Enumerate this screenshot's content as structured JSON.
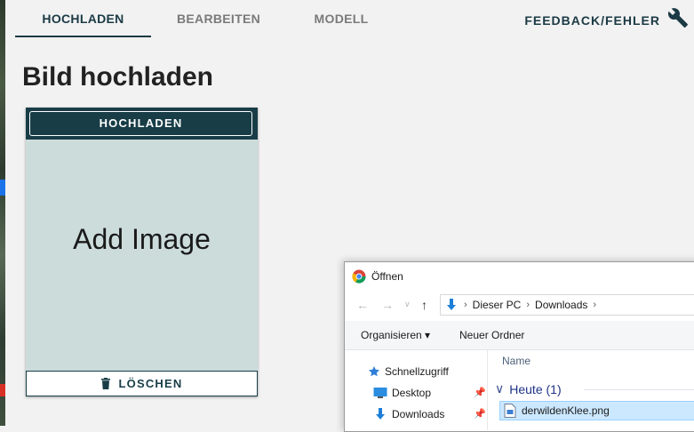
{
  "tabs": [
    {
      "label": "HOCHLADEN",
      "active": true
    },
    {
      "label": "BEARBEITEN",
      "active": false
    },
    {
      "label": "MODELL",
      "active": false
    }
  ],
  "feedback": {
    "label": "FEEDBACK/FEHLER",
    "icon": "wrench-icon"
  },
  "page_title": "Bild hochladen",
  "upload_card": {
    "upload_label": "HOCHLADEN",
    "placeholder": "Add Image",
    "delete_label": "LÖSCHEN",
    "delete_icon": "trash-icon"
  },
  "colors": {
    "primary": "#183d47",
    "card_bg": "#ccdcdb",
    "page_bg": "#f2f2f2"
  },
  "file_dialog": {
    "title": "Öffnen",
    "breadcrumb": [
      "Dieser PC",
      "Downloads"
    ],
    "toolbar": {
      "organize": "Organisieren ▾",
      "new_folder": "Neuer Ordner"
    },
    "nav_items": [
      "Schnellzugriff",
      "Desktop",
      "Downloads"
    ],
    "column_name": "Name",
    "group": "Heute (1)",
    "selected_file": "derwildenKlee.png"
  }
}
